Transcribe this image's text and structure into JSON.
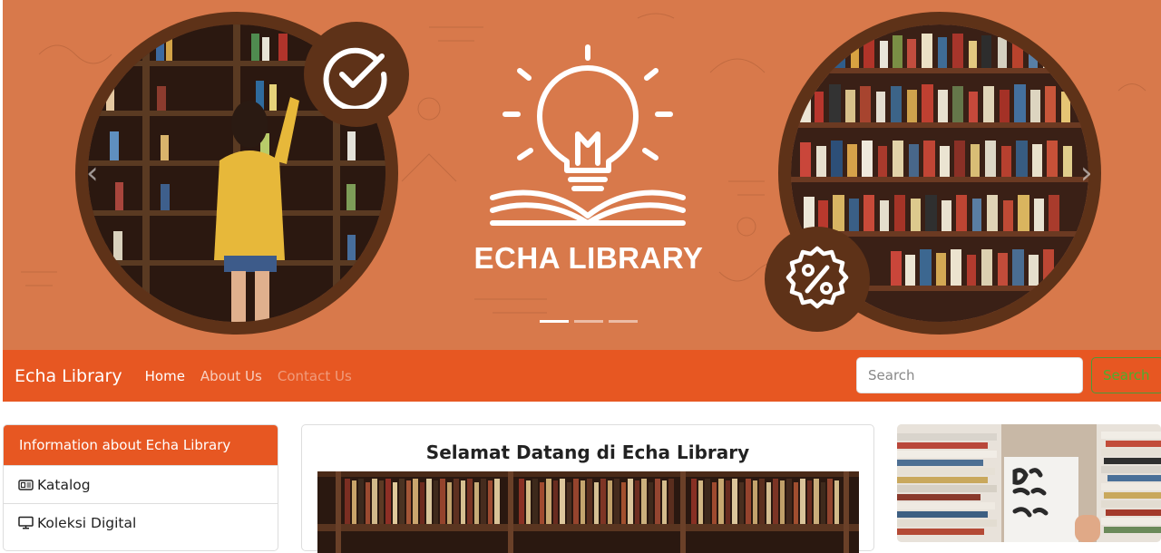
{
  "hero": {
    "logo_title": "ECHA LIBRARY",
    "indicators": [
      true,
      false,
      false
    ]
  },
  "navbar": {
    "brand": "Echa Library",
    "links": [
      "Home",
      "About Us",
      "Contact Us"
    ],
    "search_placeholder": "Search",
    "search_button": "Search"
  },
  "sidebar": {
    "header": "Information about Echa Library",
    "items": [
      {
        "label": "Katalog",
        "icon": "catalog-card-icon"
      },
      {
        "label": "Koleksi Digital",
        "icon": "monitor-icon"
      }
    ]
  },
  "main": {
    "title": "Selamat Datang di Echa Library"
  },
  "colors": {
    "hero_bg": "#d8794b",
    "circle_border": "#5e3218",
    "navbar_bg": "#e75722",
    "search_button_text": "#4cae2e"
  }
}
